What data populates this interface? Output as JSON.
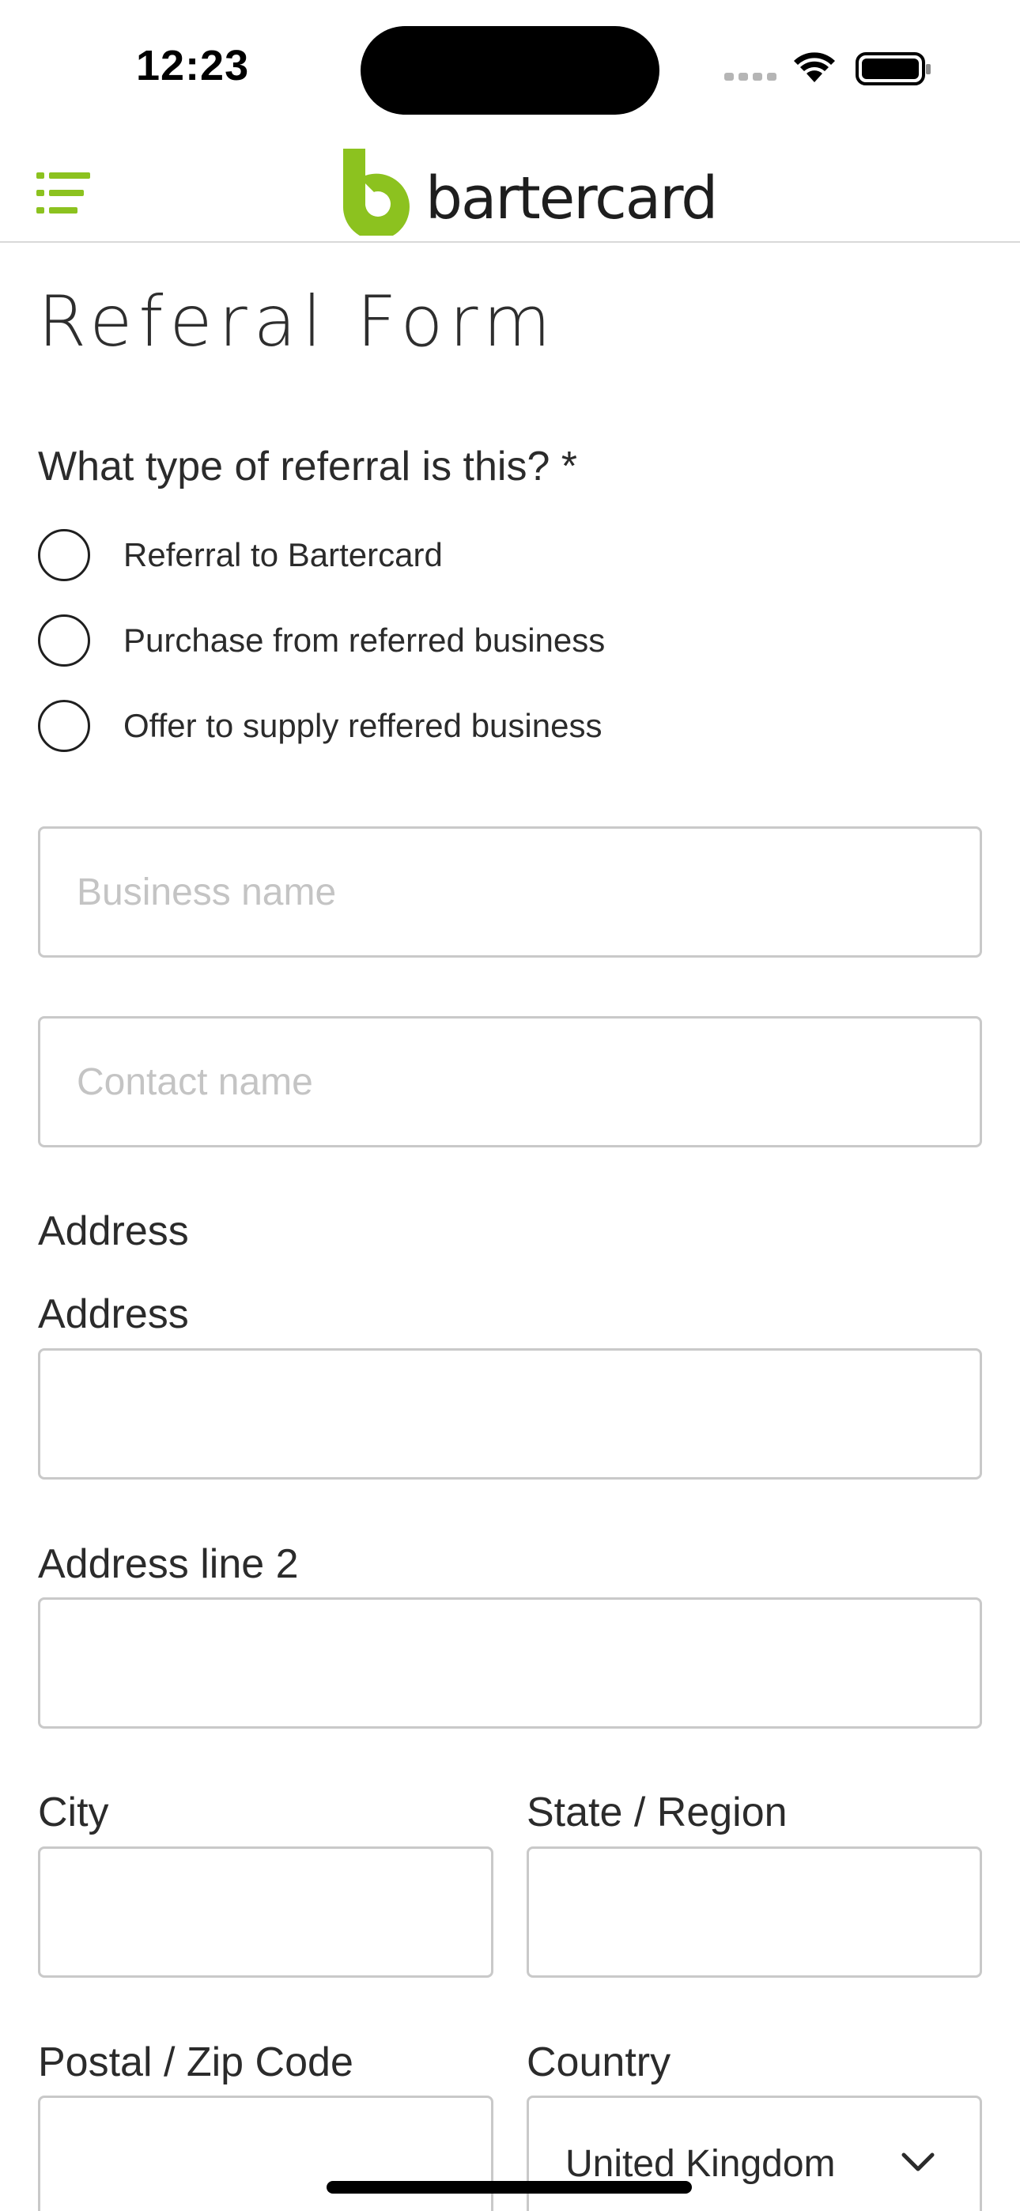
{
  "status_bar": {
    "time": "12:23"
  },
  "header": {
    "logo_text": "bartercard",
    "menu_icon": "hamburger-menu-icon",
    "brand_color": "#8cc21f"
  },
  "form": {
    "title": "Referal Form",
    "question": "What type of referral is this? *",
    "options": [
      {
        "label": "Referral to Bartercard",
        "selected": false
      },
      {
        "label": "Purchase from referred business",
        "selected": false
      },
      {
        "label": "Offer to supply reffered business",
        "selected": false
      }
    ],
    "business_name": {
      "placeholder": "Business name",
      "value": ""
    },
    "contact_name": {
      "placeholder": "Contact name",
      "value": ""
    },
    "address_section_label": "Address",
    "address": {
      "label": "Address",
      "value": ""
    },
    "address_line2": {
      "label": "Address line 2",
      "value": ""
    },
    "city": {
      "label": "City",
      "value": ""
    },
    "state": {
      "label": "State / Region",
      "value": ""
    },
    "postal": {
      "label": "Postal / Zip Code",
      "value": ""
    },
    "country": {
      "label": "Country",
      "value": "United Kingdom"
    }
  }
}
